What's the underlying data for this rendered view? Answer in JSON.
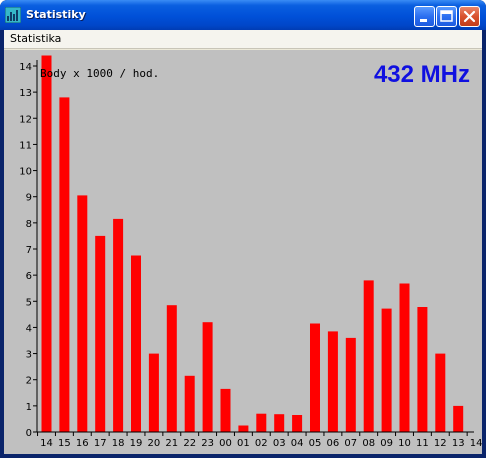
{
  "window": {
    "title": "Statistiky",
    "menu": [
      "Statistika"
    ]
  },
  "colors": {
    "bar": "#ff0000",
    "background": "#c0c0c0",
    "frequency_label": "#1010e0"
  },
  "icons": {
    "app": "app-icon",
    "minimize": "minimize-icon",
    "maximize": "maximize-icon",
    "close": "close-icon"
  },
  "chart_data": {
    "type": "bar",
    "title": "432 MHz",
    "ylabel": "Body x 1000 / hod.",
    "xlabel": "",
    "ylim": [
      0,
      14
    ],
    "yticks": [
      0,
      1,
      2,
      3,
      4,
      5,
      6,
      7,
      8,
      9,
      10,
      11,
      12,
      13,
      14
    ],
    "grid": false,
    "categories": [
      "14",
      "15",
      "16",
      "17",
      "18",
      "19",
      "20",
      "21",
      "22",
      "23",
      "00",
      "01",
      "02",
      "03",
      "04",
      "05",
      "06",
      "07",
      "08",
      "09",
      "10",
      "11",
      "12",
      "13",
      "14"
    ],
    "values": [
      14.4,
      12.8,
      9.05,
      7.5,
      8.15,
      6.75,
      3.0,
      4.85,
      2.15,
      4.2,
      1.65,
      0.25,
      0.7,
      0.68,
      0.65,
      4.15,
      3.85,
      3.6,
      5.8,
      4.72,
      5.68,
      4.78,
      3.0,
      1.0
    ]
  }
}
